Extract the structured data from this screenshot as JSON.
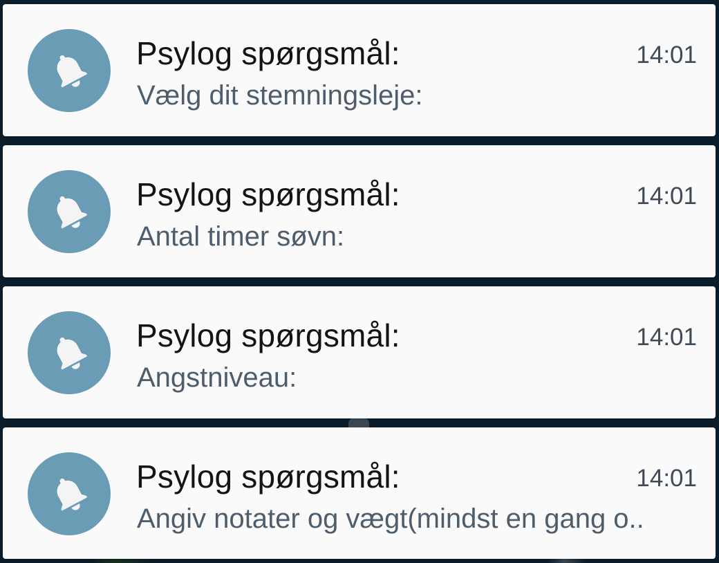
{
  "notifications": [
    {
      "icon": "bell-icon",
      "title": "Psylog spørgsmål:",
      "time": "14:01",
      "text": "Vælg dit stemningsleje:"
    },
    {
      "icon": "bell-icon",
      "title": "Psylog spørgsmål:",
      "time": "14:01",
      "text": "Antal timer søvn:"
    },
    {
      "icon": "bell-icon",
      "title": "Psylog spørgsmål:",
      "time": "14:01",
      "text": "Angstniveau:"
    },
    {
      "icon": "bell-icon",
      "title": "Psylog spørgsmål:",
      "time": "14:01",
      "text": "Angiv notater og vægt(mindst en gang o.."
    }
  ],
  "colors": {
    "background": "#0b1d2b",
    "card": "#fafafa",
    "icon_circle": "#6a9cb5",
    "title": "#141414",
    "body": "#4d5d6c",
    "time": "#3e4a55"
  }
}
